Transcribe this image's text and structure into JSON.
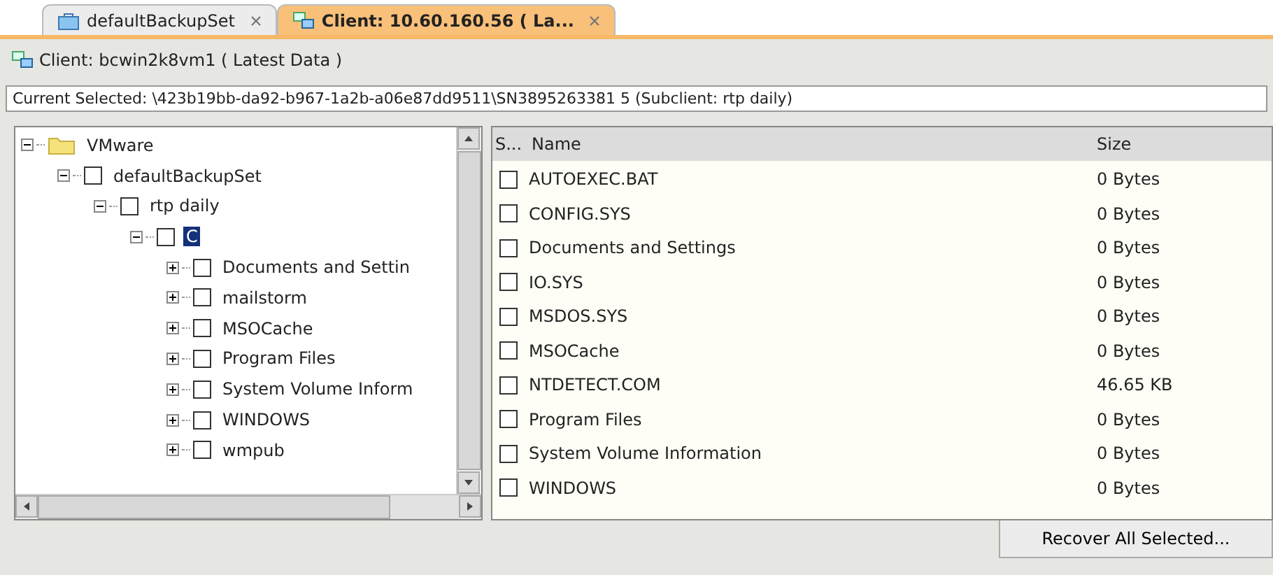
{
  "tabs": [
    {
      "label": "defaultBackupSet",
      "kind": "backupset",
      "selected": false
    },
    {
      "label": "Client: 10.60.160.56 ( La...",
      "kind": "client",
      "selected": true
    }
  ],
  "header": {
    "title": "Client: bcwin2k8vm1 ( Latest Data )"
  },
  "current_selected": "Current Selected: \\423b19bb-da92-b967-1a2b-a06e87dd9511\\SN3895263381  5 (Subclient: rtp daily)",
  "tree": [
    {
      "label": "VMware",
      "kind": "folder",
      "expanded": true,
      "selected": false,
      "children": [
        {
          "label": "defaultBackupSet",
          "kind": "check",
          "checked": false,
          "expanded": true,
          "selected": false,
          "children": [
            {
              "label": "rtp daily",
              "kind": "check",
              "checked": false,
              "expanded": true,
              "selected": false,
              "children": [
                {
                  "label": "C",
                  "kind": "check",
                  "checked": false,
                  "expanded": true,
                  "selected": true,
                  "children": [
                    {
                      "label": "Documents and Settin",
                      "kind": "check",
                      "checked": false,
                      "expanded": false,
                      "selected": false
                    },
                    {
                      "label": "mailstorm",
                      "kind": "check",
                      "checked": false,
                      "expanded": false,
                      "selected": false
                    },
                    {
                      "label": "MSOCache",
                      "kind": "check",
                      "checked": false,
                      "expanded": false,
                      "selected": false
                    },
                    {
                      "label": "Program Files",
                      "kind": "check",
                      "checked": false,
                      "expanded": false,
                      "selected": false
                    },
                    {
                      "label": "System Volume Inform",
                      "kind": "check",
                      "checked": false,
                      "expanded": false,
                      "selected": false
                    },
                    {
                      "label": "WINDOWS",
                      "kind": "check",
                      "checked": false,
                      "expanded": false,
                      "selected": false
                    },
                    {
                      "label": "wmpub",
                      "kind": "check",
                      "checked": false,
                      "expanded": false,
                      "selected": false
                    }
                  ]
                }
              ]
            }
          ]
        }
      ]
    }
  ],
  "table": {
    "columns": [
      "S...",
      "Name",
      "Size"
    ],
    "rows": [
      {
        "name": "AUTOEXEC.BAT",
        "size": "0 Bytes",
        "checked": false
      },
      {
        "name": "CONFIG.SYS",
        "size": "0 Bytes",
        "checked": false
      },
      {
        "name": "Documents and Settings",
        "size": "0 Bytes",
        "checked": false
      },
      {
        "name": "IO.SYS",
        "size": "0 Bytes",
        "checked": false
      },
      {
        "name": "MSDOS.SYS",
        "size": "0 Bytes",
        "checked": false
      },
      {
        "name": "MSOCache",
        "size": "0 Bytes",
        "checked": false
      },
      {
        "name": "NTDETECT.COM",
        "size": "46.65 KB",
        "checked": false
      },
      {
        "name": "Program Files",
        "size": "0 Bytes",
        "checked": false
      },
      {
        "name": "System Volume Information",
        "size": "0 Bytes",
        "checked": false
      },
      {
        "name": "WINDOWS",
        "size": "0 Bytes",
        "checked": false
      }
    ]
  },
  "buttons": [
    "Recover All Selected..."
  ]
}
